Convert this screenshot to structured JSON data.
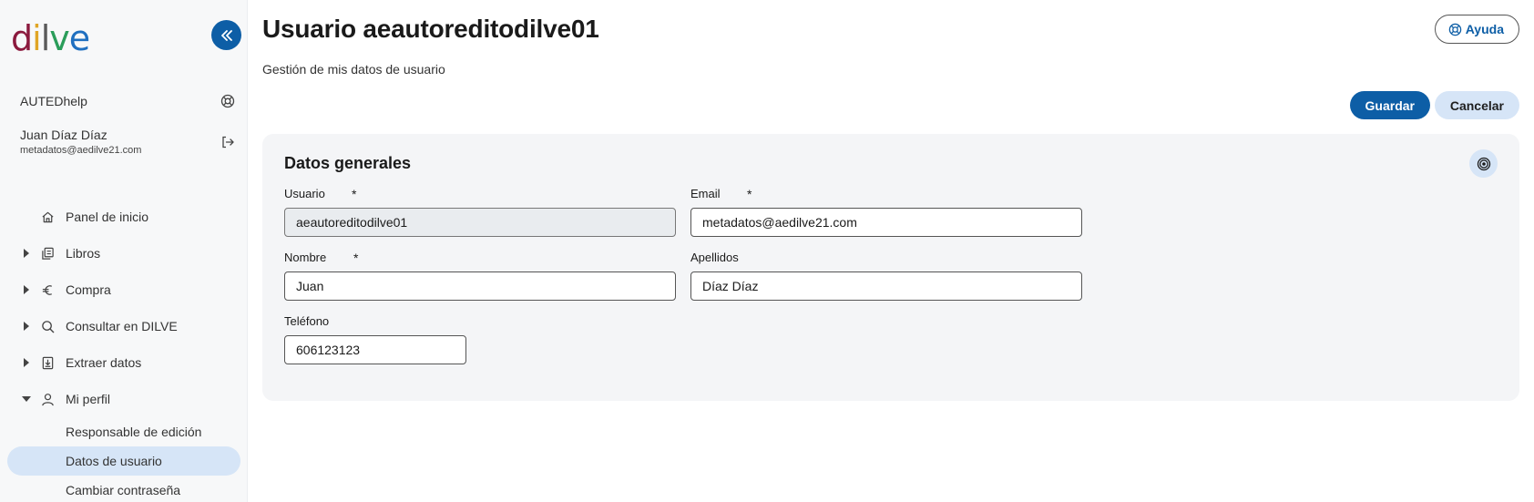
{
  "brand": {
    "logo_letters": [
      {
        "ch": "d",
        "color": "#8b1a3e"
      },
      {
        "ch": "i",
        "color": "#e0a526"
      },
      {
        "ch": "l",
        "color": "#5a5a5a"
      },
      {
        "ch": "v",
        "color": "#2a9d5a"
      },
      {
        "ch": "e",
        "color": "#1f6fc0"
      }
    ],
    "accent": "#0d5ea6",
    "accent_light": "#d6e5f7"
  },
  "sidebar": {
    "org_name": "AUTEDhelp",
    "user_name": "Juan Díaz Díaz",
    "user_email": "metadatos@aedilve21.com",
    "nav": [
      {
        "label": "Panel de inicio",
        "icon": "home-icon",
        "caret": ""
      },
      {
        "label": "Libros",
        "icon": "books-icon",
        "caret": "right"
      },
      {
        "label": "Compra",
        "icon": "euro-icon",
        "caret": "right"
      },
      {
        "label": "Consultar en DILVE",
        "icon": "search-icon",
        "caret": "right"
      },
      {
        "label": "Extraer datos",
        "icon": "download-icon",
        "caret": "right"
      },
      {
        "label": "Mi perfil",
        "icon": "user-icon",
        "caret": "down"
      }
    ],
    "profile_sub": [
      {
        "label": "Responsable de edición",
        "active": false
      },
      {
        "label": "Datos de usuario",
        "active": true
      },
      {
        "label": "Cambiar contraseña",
        "active": false
      }
    ]
  },
  "header": {
    "title": "Usuario aeautoreditodilve01",
    "subtitle": "Gestión de mis datos de usuario",
    "help_label": "Ayuda"
  },
  "toolbar": {
    "save_label": "Guardar",
    "cancel_label": "Cancelar"
  },
  "form": {
    "section_title": "Datos generales",
    "required_mark": "*",
    "usuario": {
      "label": "Usuario",
      "value": "aeautoreditodilve01"
    },
    "email": {
      "label": "Email",
      "value": "metadatos@aedilve21.com"
    },
    "nombre": {
      "label": "Nombre",
      "value": "Juan"
    },
    "apellidos": {
      "label": "Apellidos",
      "value": "Díaz Díaz"
    },
    "telefono": {
      "label": "Teléfono",
      "value": "606123123"
    }
  }
}
